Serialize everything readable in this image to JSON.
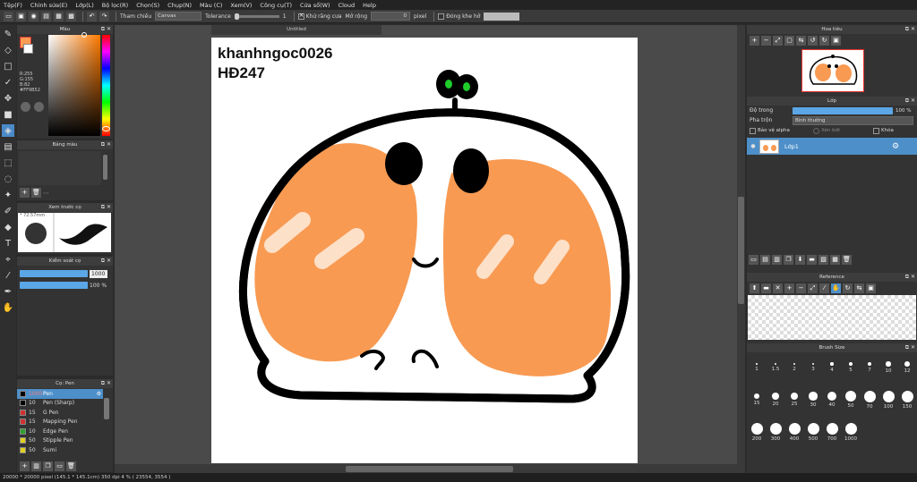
{
  "menu": [
    "Tệp(F)",
    "Chỉnh sửa(E)",
    "Lớp(L)",
    "Bộ lọc(R)",
    "Chọn(S)",
    "Chụp(N)",
    "Màu (C)",
    "Xem(V)",
    "Công cụ(T)",
    "Cửa sổ(W)",
    "Cloud",
    "Help"
  ],
  "toolbar": {
    "ref_label": "Tham chiếu",
    "ref_value": "Canvas",
    "tolerance_label": "Tolerance",
    "tolerance_value": "1",
    "antialias_label": "Khử răng cưa",
    "expand_label": "Mở rộng",
    "expand_value": "0",
    "pixel_label": "pixel",
    "close_gap_label": "Đóng khe hở"
  },
  "color_panel": {
    "title": "Màu",
    "r": "R:255",
    "g": "G:155",
    "b": "B:82",
    "hex": "#FF9B52",
    "primary": "#ff9b52",
    "secondary": "#ffffff"
  },
  "palette_panel": {
    "title": "Bảng màu"
  },
  "brush_preview": {
    "title": "Xem trước cọ",
    "size": "72.57mm"
  },
  "brush_control": {
    "title": "Kiểm soát cọ",
    "size_value": "1000",
    "opacity_value": "100 %",
    "size_fraction": 1.0,
    "opacity_fraction": 1.0
  },
  "brush_list": {
    "title": "Cọ: Pen",
    "items": [
      {
        "size": "1000",
        "name": "Pen",
        "color": "#000000",
        "selected": true
      },
      {
        "size": "10",
        "name": "Pen (Sharp)",
        "color": "#000000",
        "selected": false
      },
      {
        "size": "15",
        "name": "G Pen",
        "color": "#d03030",
        "selected": false
      },
      {
        "size": "15",
        "name": "Mapping Pen",
        "color": "#d03030",
        "selected": false
      },
      {
        "size": "10",
        "name": "Edge Pen",
        "color": "#30a030",
        "selected": false
      },
      {
        "size": "50",
        "name": "Stipple Pen",
        "color": "#e0d020",
        "selected": false
      },
      {
        "size": "50",
        "name": "Sumi",
        "color": "#e0d020",
        "selected": false
      }
    ]
  },
  "document": {
    "title": "Untitled",
    "text_line1": "khanhngoc0026",
    "text_line2": "HĐ247"
  },
  "navigator": {
    "title": "Hoa tiêu"
  },
  "layer_panel": {
    "title": "Lớp",
    "opacity_label": "Độ trong",
    "opacity_value": "100 %",
    "opacity_fraction": 1.0,
    "blend_label": "Pha trộn",
    "blend_value": "Bình thường",
    "protect_alpha": "Bảo vệ alpha",
    "clipping": "Xén bớt",
    "lock": "Khóa",
    "layer_name": "Lớp1"
  },
  "reference_panel": {
    "title": "Reference"
  },
  "brush_size_panel": {
    "title": "Brush Size",
    "sizes": [
      "1",
      "1.5",
      "2",
      "3",
      "4",
      "5",
      "7",
      "10",
      "12",
      "15",
      "20",
      "25",
      "30",
      "40",
      "50",
      "70",
      "100",
      "150",
      "200",
      "300",
      "400",
      "500",
      "700",
      "1000"
    ]
  },
  "status": {
    "text": "20000 * 20000 pixel  (145.1 * 145.1cm)  350 dpi  4 %  ( 23554, 3554 )"
  }
}
